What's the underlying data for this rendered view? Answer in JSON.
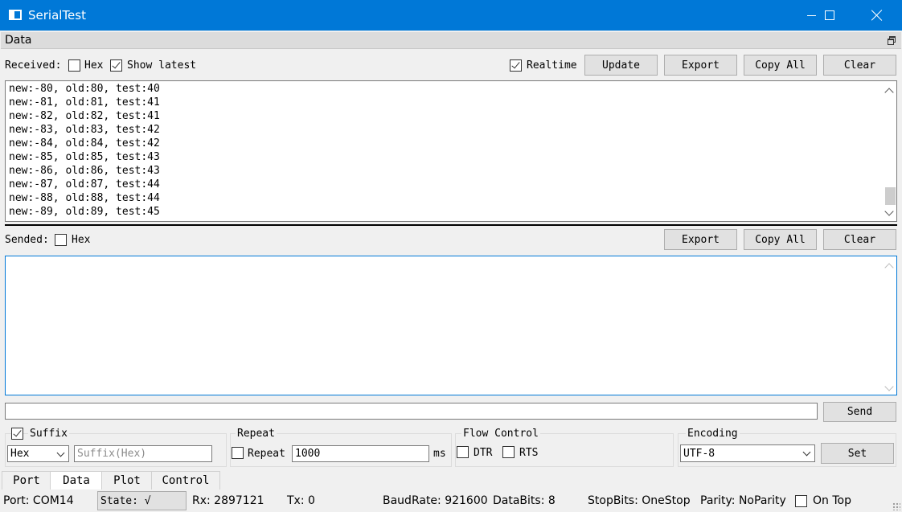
{
  "window": {
    "title": "SerialTest"
  },
  "dock": {
    "title": "Data"
  },
  "received": {
    "label": "Received:",
    "hex_label": "Hex",
    "hex_checked": false,
    "show_latest_label": "Show latest",
    "show_latest_checked": true,
    "realtime_label": "Realtime",
    "realtime_checked": true,
    "buttons": {
      "update": "Update",
      "export": "Export",
      "copy_all": "Copy All",
      "clear": "Clear"
    },
    "log": "new:-80, old:80, test:40\nnew:-81, old:81, test:41\nnew:-82, old:82, test:41\nnew:-83, old:83, test:42\nnew:-84, old:84, test:42\nnew:-85, old:85, test:43\nnew:-86, old:86, test:43\nnew:-87, old:87, test:44\nnew:-88, old:88, test:44\nnew:-89, old:89, test:45"
  },
  "sended": {
    "label": "Sended:",
    "hex_label": "Hex",
    "hex_checked": false,
    "buttons": {
      "export": "Export",
      "copy_all": "Copy All",
      "clear": "Clear"
    },
    "text": ""
  },
  "send": {
    "input_value": "",
    "button": "Send"
  },
  "suffix": {
    "label": "Suffix",
    "checked": true,
    "type_value": "Hex",
    "placeholder": "Suffix(Hex)"
  },
  "repeat": {
    "group_title": "Repeat",
    "checkbox_label": "Repeat",
    "checked": false,
    "interval_value": "1000",
    "unit": "ms"
  },
  "flow_control": {
    "group_title": "Flow Control",
    "dtr_label": "DTR",
    "dtr_checked": false,
    "rts_label": "RTS",
    "rts_checked": false
  },
  "encoding": {
    "group_title": "Encoding",
    "value": "UTF-8",
    "set_button": "Set"
  },
  "tabs": [
    "Port",
    "Data",
    "Plot",
    "Control"
  ],
  "active_tab": "Data",
  "status": {
    "port": "Port: COM14",
    "state": "State: √",
    "rx": "Rx: 2897121",
    "tx": "Tx: 0",
    "baud": "BaudRate: 921600",
    "databits": "DataBits: 8",
    "stopbits": "StopBits: OneStop",
    "parity": "Parity: NoParity",
    "on_top_label": "On Top",
    "on_top_checked": false
  }
}
